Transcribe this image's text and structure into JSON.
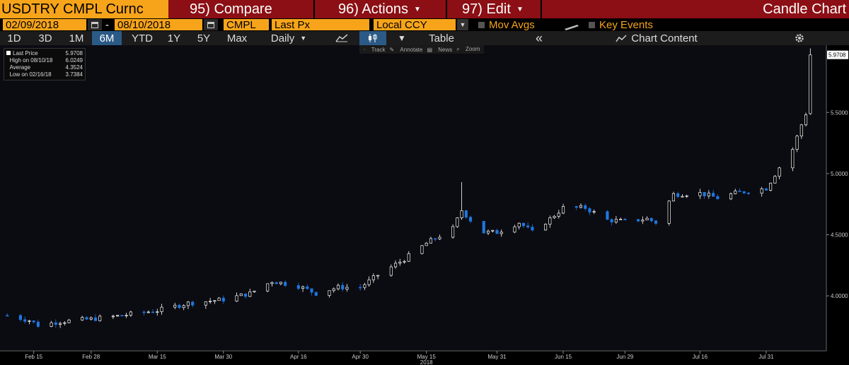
{
  "header": {
    "ticker": "USDTRY CMPL Curnc",
    "compare": "95) Compare",
    "actions": "96) Actions",
    "edit": "97) Edit",
    "chart_type_title": "Candle Chart"
  },
  "controls": {
    "start_date": "02/09/2018",
    "date_sep": "-",
    "end_date": "08/10/2018",
    "source": "CMPL",
    "field": "Last Px",
    "currency": "Local CCY",
    "mov_avgs": "Mov Avgs",
    "key_events": "Key Events"
  },
  "toolbar": {
    "ranges": [
      "1D",
      "3D",
      "1M",
      "6M",
      "YTD",
      "1Y",
      "5Y",
      "Max"
    ],
    "active_range": "6M",
    "period": "Daily",
    "table": "Table",
    "collapse": "«",
    "chart_content": "Chart Content"
  },
  "subtools": {
    "track": "Track",
    "annotate": "Annotate",
    "news": "News",
    "zoom": "Zoom"
  },
  "legend": {
    "last_label": "Last Price",
    "last_value": "5.9708",
    "high_label": "High on 08/10/18",
    "high_value": "6.0249",
    "avg_label": "Average",
    "avg_value": "4.3524",
    "low_label": "Low on 02/16/18",
    "low_value": "3.7384"
  },
  "colors": {
    "up": "#ffffff",
    "down": "#1e78e0",
    "accent": "#f7a41a",
    "header": "#8b0f14"
  },
  "chart_data": {
    "type": "candlestick",
    "xlabel": "2018",
    "ylim": [
      3.55,
      6.05
    ],
    "yticks": [
      4.0,
      4.5,
      5.0,
      5.5
    ],
    "ytick_labels": [
      "4.0000",
      "4.5000",
      "5.0000",
      "5.5000"
    ],
    "last_price_label": "5.9708",
    "xticks": [
      {
        "date": "2018-02-15",
        "label": "Feb 15"
      },
      {
        "date": "2018-02-28",
        "label": "Feb 28"
      },
      {
        "date": "2018-03-15",
        "label": "Mar 15"
      },
      {
        "date": "2018-03-30",
        "label": "Mar 30"
      },
      {
        "date": "2018-04-16",
        "label": "Apr 16"
      },
      {
        "date": "2018-04-30",
        "label": "Apr 30"
      },
      {
        "date": "2018-05-15",
        "label": "May 15"
      },
      {
        "date": "2018-05-31",
        "label": "May 31"
      },
      {
        "date": "2018-06-15",
        "label": "Jun 15"
      },
      {
        "date": "2018-06-29",
        "label": "Jun 29"
      },
      {
        "date": "2018-07-16",
        "label": "Jul 16"
      },
      {
        "date": "2018-07-31",
        "label": "Jul 31"
      }
    ],
    "close_path": [
      [
        "2018-02-09",
        3.84
      ],
      [
        "2018-02-14",
        3.8
      ],
      [
        "2018-02-16",
        3.76
      ],
      [
        "2018-02-21",
        3.79
      ],
      [
        "2018-02-28",
        3.81
      ],
      [
        "2018-03-05",
        3.83
      ],
      [
        "2018-03-15",
        3.88
      ],
      [
        "2018-03-22",
        3.94
      ],
      [
        "2018-03-30",
        3.97
      ],
      [
        "2018-04-05",
        4.02
      ],
      [
        "2018-04-10",
        4.12
      ],
      [
        "2018-04-16",
        4.08
      ],
      [
        "2018-04-20",
        4.02
      ],
      [
        "2018-04-25",
        4.07
      ],
      [
        "2018-04-30",
        4.07
      ],
      [
        "2018-05-04",
        4.17
      ],
      [
        "2018-05-10",
        4.3
      ],
      [
        "2018-05-15",
        4.43
      ],
      [
        "2018-05-21",
        4.55
      ],
      [
        "2018-05-23",
        4.7
      ],
      [
        "2018-05-25",
        4.62
      ],
      [
        "2018-05-28",
        4.52
      ],
      [
        "2018-05-31",
        4.52
      ],
      [
        "2018-06-05",
        4.6
      ],
      [
        "2018-06-08",
        4.52
      ],
      [
        "2018-06-12",
        4.63
      ],
      [
        "2018-06-15",
        4.72
      ],
      [
        "2018-06-20",
        4.72
      ],
      [
        "2018-06-25",
        4.62
      ],
      [
        "2018-06-29",
        4.61
      ],
      [
        "2018-07-04",
        4.63
      ],
      [
        "2018-07-06",
        4.6
      ],
      [
        "2018-07-10",
        4.83
      ],
      [
        "2018-07-16",
        4.84
      ],
      [
        "2018-07-20",
        4.8
      ],
      [
        "2018-07-24",
        4.84
      ],
      [
        "2018-07-31",
        4.88
      ],
      [
        "2018-08-03",
        5.05
      ],
      [
        "2018-08-06",
        5.2
      ],
      [
        "2018-08-08",
        5.4
      ],
      [
        "2018-08-09",
        5.49
      ],
      [
        "2018-08-10",
        5.97
      ]
    ]
  }
}
